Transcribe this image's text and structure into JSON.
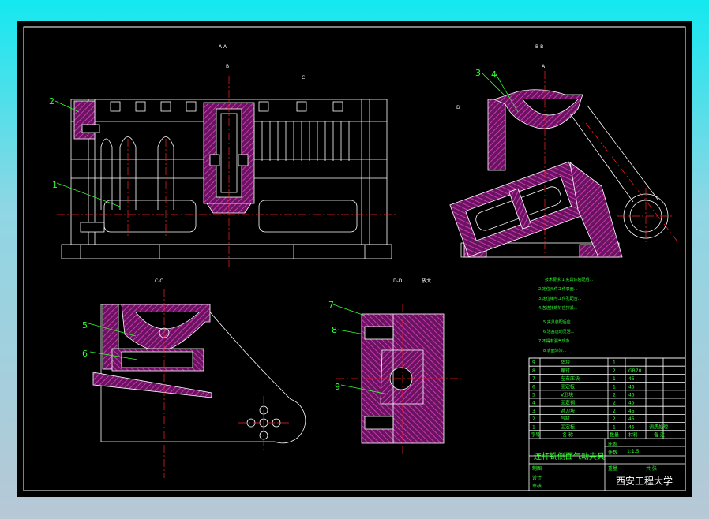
{
  "views": {
    "aa": "A-A",
    "bb": "B-B",
    "cc": "C-C",
    "dd": "D-D",
    "dd_scale": "放大",
    "sec_b": "B",
    "sec_c": "C",
    "sec_d": "D",
    "sec_a": "A"
  },
  "balloons": [
    "1",
    "2",
    "3",
    "4",
    "5",
    "6",
    "7",
    "8",
    "9"
  ],
  "notes": [
    "技术要求 1.夹具体装配后...",
    "2.定位元件工作表面...",
    "3.定位销与工件孔配合...",
    "4.各连接螺钉应拧紧...",
    "5.夹具装配后应...",
    "6.活塞运动灵活...",
    "7.不得有漏气现象...",
    "8.表面涂漆..."
  ],
  "bom": {
    "rows": [
      {
        "no": "9",
        "name": "垫块",
        "qty": "1",
        "material": "",
        "note": ""
      },
      {
        "no": "8",
        "name": "螺钉",
        "qty": "2",
        "material": "GB70",
        "note": ""
      },
      {
        "no": "7",
        "name": "左右压块",
        "qty": "1",
        "material": "45",
        "note": ""
      },
      {
        "no": "6",
        "name": "固定板",
        "qty": "1",
        "material": "45",
        "note": ""
      },
      {
        "no": "5",
        "name": "V形块",
        "qty": "2",
        "material": "45",
        "note": ""
      },
      {
        "no": "4",
        "name": "固定销",
        "qty": "2",
        "material": "45",
        "note": ""
      },
      {
        "no": "3",
        "name": "对刀块",
        "qty": "2",
        "material": "45",
        "note": ""
      },
      {
        "no": "2",
        "name": "气缸",
        "qty": "2",
        "material": "45",
        "note": ""
      },
      {
        "no": "1",
        "name": "固定板",
        "qty": "1",
        "material": "45",
        "note": "调质处理"
      }
    ],
    "header": {
      "no": "序号",
      "name": "名 称",
      "qty": "数量",
      "material": "材料",
      "note": "备 注"
    },
    "title": "连杆铣侧面气动夹具",
    "ratio": "比例",
    "qty_label": "件数",
    "scale_value": "1:1.5",
    "weight_label": "重量",
    "sheet_label": "共 张",
    "drawn": "制图",
    "designer": "设计",
    "checked": "审核",
    "school": "西安工程大学"
  },
  "colors": {
    "outline": "#ffffff",
    "centerline": "#ff2020",
    "hatch": "#b0239a",
    "leader": "#30ff30",
    "label": "#30ff30"
  }
}
